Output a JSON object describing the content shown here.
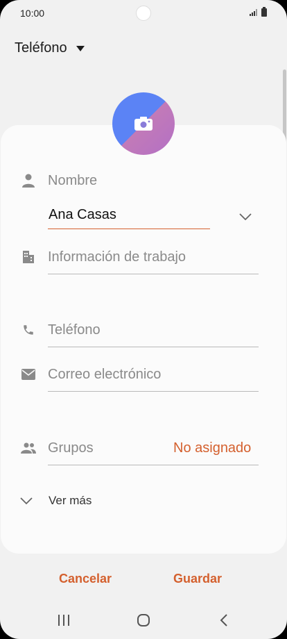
{
  "status_bar": {
    "time": "10:00"
  },
  "account": {
    "label": "Teléfono"
  },
  "colors": {
    "accent": "#d4602e",
    "background": "#f1f1f1",
    "card": "#fbfbfb"
  },
  "form": {
    "name": {
      "placeholder": "Nombre",
      "value": "Ana Casas"
    },
    "work": {
      "placeholder": "Información de trabajo"
    },
    "phone": {
      "placeholder": "Teléfono"
    },
    "email": {
      "placeholder": "Correo electrónico"
    },
    "groups": {
      "label": "Grupos",
      "value": "No asignado"
    },
    "more": {
      "label": "Ver más"
    }
  },
  "actions": {
    "cancel": "Cancelar",
    "save": "Guardar"
  },
  "icons": [
    "camera-icon",
    "person-icon",
    "building-icon",
    "phone-icon",
    "mail-icon",
    "groups-icon",
    "chevron-down-icon",
    "recent-apps-icon",
    "home-icon",
    "back-icon"
  ]
}
